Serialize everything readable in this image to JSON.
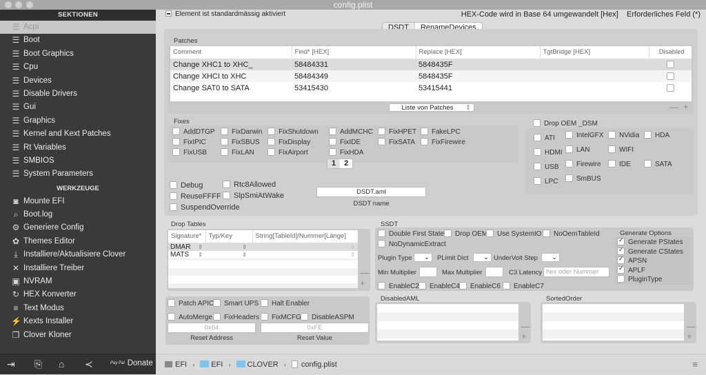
{
  "window": {
    "title": "config.plist"
  },
  "sidebar": {
    "sections_header": "SEKTIONEN",
    "sections": [
      {
        "label": "Acpi",
        "icon": "list-icon",
        "active": true
      },
      {
        "label": "Boot",
        "icon": "list-icon"
      },
      {
        "label": "Boot Graphics",
        "icon": "list-icon"
      },
      {
        "label": "Cpu",
        "icon": "list-icon"
      },
      {
        "label": "Devices",
        "icon": "list-icon"
      },
      {
        "label": "Disable Drivers",
        "icon": "list-icon"
      },
      {
        "label": "Gui",
        "icon": "list-icon"
      },
      {
        "label": "Graphics",
        "icon": "list-icon"
      },
      {
        "label": "Kernel and Kext Patches",
        "icon": "list-icon"
      },
      {
        "label": "Rt Variables",
        "icon": "list-icon"
      },
      {
        "label": "SMBIOS",
        "icon": "list-icon"
      },
      {
        "label": "System Parameters",
        "icon": "list-icon"
      }
    ],
    "tools_header": "WERKZEUGE",
    "tools": [
      {
        "label": "Mounte EFI",
        "icon": "disk-icon"
      },
      {
        "label": "Boot.log",
        "icon": "log-search-icon"
      },
      {
        "label": "Generiere Config",
        "icon": "gears-icon"
      },
      {
        "label": "Themes Editor",
        "icon": "palette-icon"
      },
      {
        "label": "Installiere/Aktualisiere Clover",
        "icon": "download-icon"
      },
      {
        "label": "Installiere Treiber",
        "icon": "tools-icon"
      },
      {
        "label": "NVRAM",
        "icon": "chip-icon"
      },
      {
        "label": "HEX Konverter",
        "icon": "convert-icon"
      },
      {
        "label": "Text Modus",
        "icon": "text-lines-icon"
      },
      {
        "label": "Kexts Installer",
        "icon": "plug-icon"
      },
      {
        "label": "Clover Kloner",
        "icon": "clone-icon"
      }
    ],
    "bottom": {
      "donate_label": "Donate",
      "paypal_label": "Pay Pal"
    }
  },
  "topbar": {
    "default_enabled": "Element ist standardmässig aktiviert",
    "hex_note": "HEX-Code wird in Base 64 umgewandelt [Hex]",
    "required_note": "Erforderliches Feld (*)"
  },
  "tabs": [
    {
      "label": "DSDT",
      "selected": true
    },
    {
      "label": "RenameDevices"
    }
  ],
  "patches": {
    "title": "Patches",
    "columns": [
      "Comment",
      "Find* [HEX]",
      "Replace [HEX]",
      "TgtBridge [HEX]",
      "Disabled"
    ],
    "rows": [
      {
        "comment": "Change XHC1 to XHC_",
        "find": "58484331",
        "replace": "5848435F",
        "tgtbridge": "",
        "disabled": false
      },
      {
        "comment": "Change XHCI to XHC",
        "find": "58484349",
        "replace": "5848435F",
        "tgtbridge": "",
        "disabled": false
      },
      {
        "comment": "Change SAT0 to SATA",
        "find": "53415430",
        "replace": "53415441",
        "tgtbridge": "",
        "disabled": false
      }
    ],
    "list_select": "Liste von Patches"
  },
  "fixes": {
    "title": "Fixes",
    "items": [
      [
        "AddDTGP",
        "FixDarwin",
        "FixShutdown",
        "AddMCHC",
        "FixHPET",
        "FakeLPC"
      ],
      [
        "FixIPIC",
        "FixSBUS",
        "FixDisplay",
        "FixIDE",
        "FixSATA",
        "FixFirewire"
      ],
      [
        "FixUSB",
        "FixLAN",
        "FixAirport",
        "FixHDA"
      ]
    ],
    "pages": [
      "1",
      "2"
    ],
    "current_page": "1"
  },
  "dsm": {
    "drop_oem_dsm": "Drop OEM _DSM",
    "items": [
      [
        "ATI",
        "IntelGFX",
        "NVidia",
        "HDA"
      ],
      [
        "HDMI",
        "LAN",
        "WIFI"
      ],
      [
        "USB",
        "Firewire",
        "IDE",
        "SATA"
      ],
      [
        "LPC",
        "SmBUS"
      ]
    ]
  },
  "misc": {
    "debug": "Debug",
    "rtc8": "Rtc8Allowed",
    "reuse": "ReuseFFFF",
    "slpsmi": "SlpSmiAtWake",
    "suspend": "SuspendOverride",
    "dsdt_name_value": "DSDT.aml",
    "dsdt_name_label": "DSDT name"
  },
  "drop_tables": {
    "title": "Drop Tables",
    "columns": [
      "Signature*",
      "Typ/Key",
      "String[TableId]/Nummer[Länge]"
    ],
    "rows": [
      {
        "signature": "DMAR"
      },
      {
        "signature": "MATS"
      }
    ]
  },
  "ssdt": {
    "title": "SSDT",
    "checks1": [
      "Double First State",
      "Drop OEM",
      "Use SystemIO",
      "NoOemTableId"
    ],
    "checks2": [
      "NoDynamicExtract"
    ],
    "plugin_type": "Plugin Type",
    "plimit": "PLimit Dict",
    "undervolt": "UnderVolt Step",
    "min_mult": "Min Multiplier",
    "max_mult": "Max Multiplier",
    "c3": "C3 Latency",
    "c3_placeholder": "hex oder Nummer",
    "enable": [
      "EnableC2",
      "EnableC4",
      "EnableC6",
      "EnableC7"
    ],
    "generate": {
      "title": "Generate Options",
      "items": [
        {
          "label": "Generate PStates",
          "checked": true
        },
        {
          "label": "Generate CStates",
          "checked": true
        },
        {
          "label": "APSN",
          "checked": true
        },
        {
          "label": "APLF",
          "checked": true
        },
        {
          "label": "PluginType",
          "checked": false
        }
      ]
    }
  },
  "lower": {
    "patch_apic": "Patch APIC",
    "smart_ups": "Smart UPS",
    "halt": "Halt Enabler",
    "automerge": "AutoMerge",
    "fixheaders": "FixHeaders",
    "fixmcfg": "FixMCFG",
    "disableaspm": "DisableASPM",
    "reset_address_ph": "0x64",
    "reset_address_label": "Reset Address",
    "reset_value_ph": "0xFE",
    "reset_value_label": "Reset Value"
  },
  "disabled_aml": {
    "title": "DisabledAML"
  },
  "sorted_order": {
    "title": "SortedOrder"
  },
  "statusbar": {
    "path": [
      "EFI",
      "EFI",
      "CLOVER",
      "config.plist"
    ]
  }
}
